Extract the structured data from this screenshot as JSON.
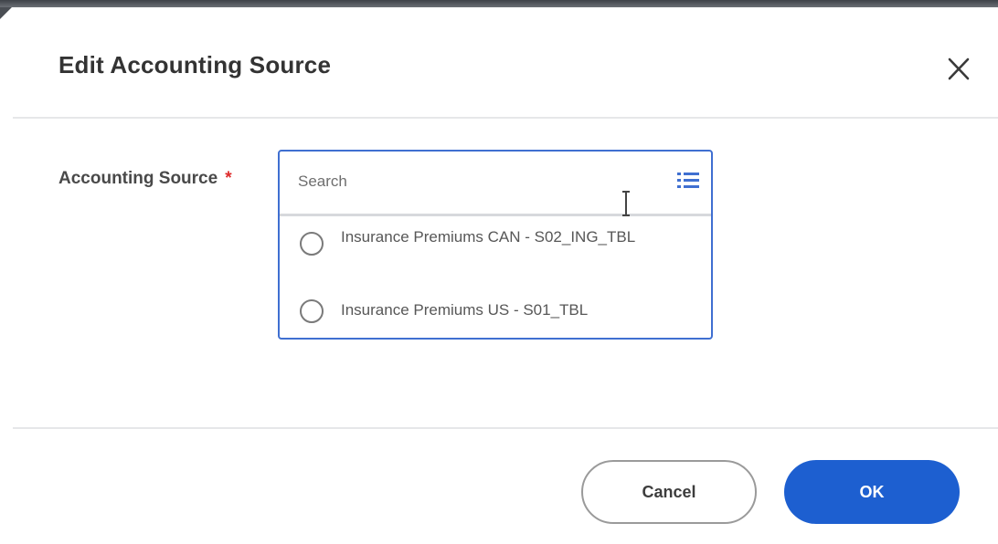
{
  "dialog": {
    "title": "Edit Accounting Source",
    "close_icon": "close-icon"
  },
  "field": {
    "label": "Accounting Source",
    "required_marker": "*",
    "required_color": "#de2b2b"
  },
  "prompt": {
    "search_placeholder": "Search",
    "search_value": "",
    "list_icon": "list-view-icon",
    "options": [
      {
        "label": "Insurance Premiums CAN - S02_ING_TBL",
        "selected": false
      },
      {
        "label": "Insurance Premiums US - S01_TBL",
        "selected": false
      }
    ],
    "border_color": "#3f6fd1"
  },
  "footer": {
    "cancel_label": "Cancel",
    "ok_label": "OK",
    "ok_color": "#1d5fd0"
  }
}
